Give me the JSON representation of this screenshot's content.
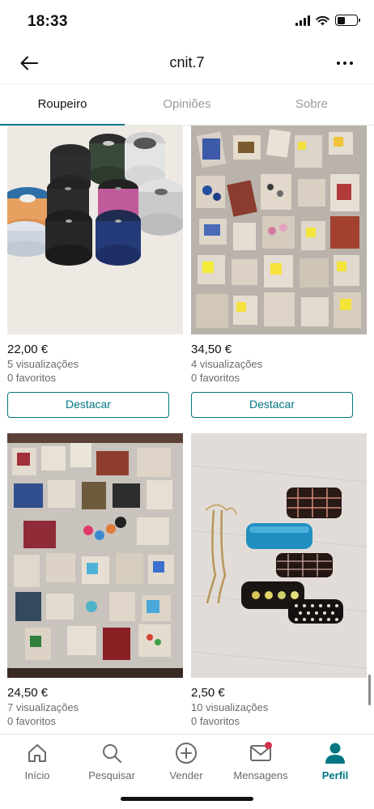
{
  "status_bar": {
    "time": "18:33"
  },
  "header": {
    "title": "cnit.7"
  },
  "tabs": [
    {
      "label": "Roupeiro",
      "active": true
    },
    {
      "label": "Opiniões",
      "active": false
    },
    {
      "label": "Sobre",
      "active": false
    }
  ],
  "items": [
    {
      "price": "22,00 €",
      "views": "5 visualizações",
      "favorites": "0 favoritos",
      "button": "Destacar",
      "photo": "spools of cord"
    },
    {
      "price": "34,50 €",
      "views": "4 visualizações",
      "favorites": "0 favoritos",
      "button": "Destacar",
      "photo": "bags of beads"
    },
    {
      "price": "24,50 €",
      "views": "7 visualizações",
      "favorites": "0 favoritos",
      "photo": "craft supplies"
    },
    {
      "price": "2,50 €",
      "views": "10 visualizações",
      "favorites": "0 favoritos",
      "photo": "hair clips"
    }
  ],
  "bottom_nav": [
    {
      "label": "Início",
      "icon": "home-icon"
    },
    {
      "label": "Pesquisar",
      "icon": "search-icon"
    },
    {
      "label": "Vender",
      "icon": "plus-circle-icon"
    },
    {
      "label": "Mensagens",
      "icon": "mail-icon"
    },
    {
      "label": "Perfil",
      "icon": "profile-icon",
      "active": true
    }
  ],
  "colors": {
    "accent": "#007782",
    "badge": "#d33149"
  }
}
